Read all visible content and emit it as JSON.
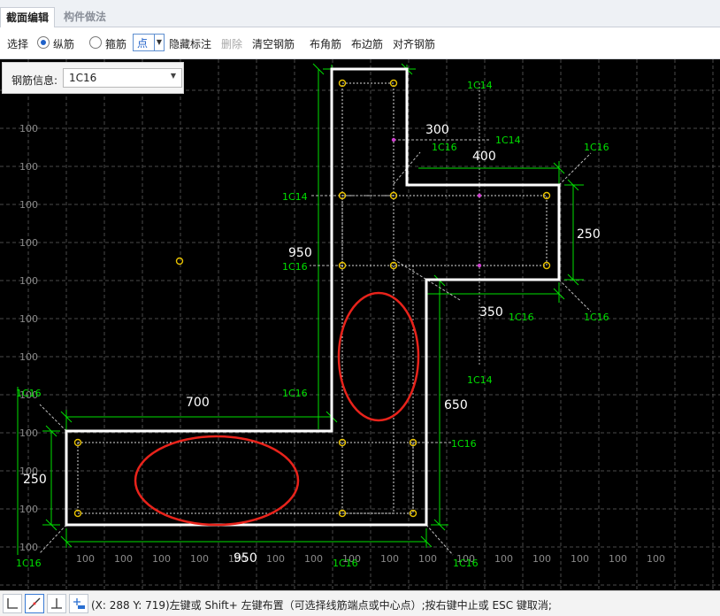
{
  "tabs": [
    "截面编辑",
    "构件做法"
  ],
  "toolbar": {
    "select": "选择",
    "longitudinal": "纵筋",
    "stirrup": "箍筋",
    "mode": "点",
    "hide_annotation": "隐藏标注",
    "delete": "删除",
    "clear": "清空钢筋",
    "corner": "布角筋",
    "edge": "布边筋",
    "align": "对齐钢筋"
  },
  "info": {
    "label": "钢筋信息:",
    "value": "1C16"
  },
  "grid": {
    "left_labels": [
      "100",
      "100",
      "100",
      "100",
      "100",
      "100",
      "100",
      "100",
      "100",
      "100",
      "100",
      "100"
    ],
    "bottom_labels": [
      "100",
      "100",
      "100",
      "100",
      "100",
      "100",
      "100",
      "100",
      "100",
      "100",
      "100",
      "100",
      "100",
      "100",
      "100",
      "100"
    ]
  },
  "dimensions": {
    "d300": "300",
    "d400": "400",
    "d250_right": "250",
    "d950_left": "950",
    "d350": "350",
    "d650": "650",
    "d700": "700",
    "d250_left": "250",
    "d950_bottom": "950"
  },
  "rebar_labels": {
    "r_1c14": "1C14",
    "r_1c16": "1C16"
  },
  "status": {
    "coords": "(X: 288 Y: 719)",
    "message": "左键或 Shift+ 左键布置（可选择线筋端点或中心点）;按右键中止或 ESC 键取消;"
  },
  "colors": {
    "canvas_bg": "#000000",
    "grid": "#5a5a5a",
    "section": "#ffffff",
    "dimension": "#00ff00",
    "rebar_marker": "#e8c200",
    "highlight": "#e8231b"
  }
}
